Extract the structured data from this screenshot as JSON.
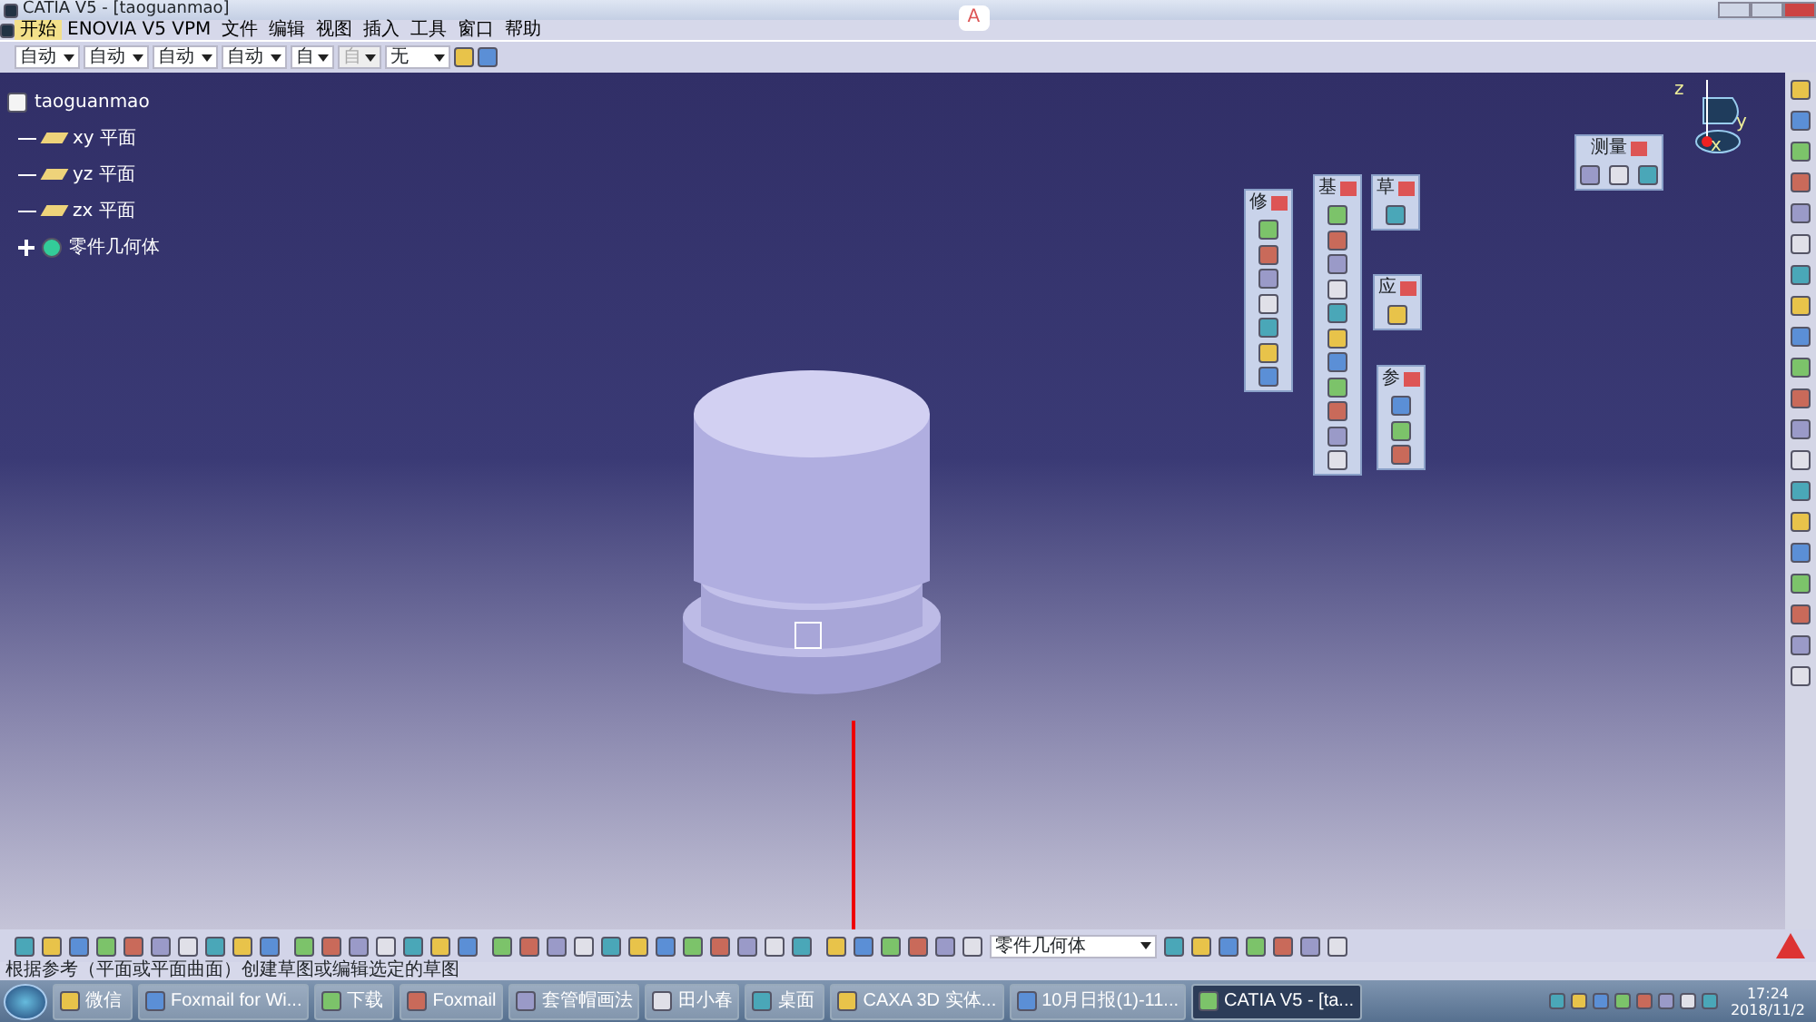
{
  "window": {
    "title": "CATIA V5 - [taoguanmao]"
  },
  "ime_bar": {
    "label": "A"
  },
  "menu": [
    {
      "label": "开始",
      "selected": true
    },
    {
      "label": "ENOVIA V5 VPM",
      "selected": false
    },
    {
      "label": "文件",
      "selected": false
    },
    {
      "label": "编辑",
      "selected": false
    },
    {
      "label": "视图",
      "selected": false
    },
    {
      "label": "插入",
      "selected": false
    },
    {
      "label": "工具",
      "selected": false
    },
    {
      "label": "窗口",
      "selected": false
    },
    {
      "label": "帮助",
      "selected": false
    }
  ],
  "style_toolbar": [
    {
      "value": "自动",
      "disabled": false
    },
    {
      "value": "自动",
      "disabled": false
    },
    {
      "value": "自动",
      "disabled": false
    },
    {
      "value": "自动",
      "disabled": false
    },
    {
      "value": "自",
      "disabled": false
    },
    {
      "value": "自",
      "disabled": true
    },
    {
      "value": "无",
      "disabled": false
    }
  ],
  "tree": {
    "label": "taoguanmao",
    "children": [
      {
        "label": "xy 平面",
        "kind": "plane"
      },
      {
        "label": "yz 平面",
        "kind": "plane"
      },
      {
        "label": "zx 平面",
        "kind": "plane"
      },
      {
        "label": "零件几何体",
        "kind": "body",
        "expanded": false
      }
    ]
  },
  "floating_toolbars": [
    {
      "title": "修"
    },
    {
      "title": "基"
    },
    {
      "title": "草"
    },
    {
      "title": "应"
    },
    {
      "title": "参"
    },
    {
      "title": "测量"
    }
  ],
  "compass": {
    "x_label": "x",
    "y_label": "y",
    "z_label": "z"
  },
  "bottom_toolbar": {
    "combo": "零件几何体"
  },
  "status_bar": {
    "message": "根据参考（平面或平面曲面）创建草图或编辑选定的草图"
  },
  "taskbar": {
    "buttons": [
      {
        "label": "微信",
        "selected": false
      },
      {
        "label": "Foxmail for Wi...",
        "selected": false
      },
      {
        "label": "下载",
        "selected": false
      },
      {
        "label": "Foxmail",
        "selected": false
      },
      {
        "label": "套管帽画法",
        "selected": false
      },
      {
        "label": "田小春",
        "selected": false
      },
      {
        "label": "桌面",
        "selected": false
      },
      {
        "label": "CAXA 3D 实体...",
        "selected": false
      },
      {
        "label": "10月日报(1)-11...",
        "selected": false
      },
      {
        "label": "CATIA V5 - [ta...",
        "selected": true
      }
    ],
    "time": "17:24",
    "date": "2018/11/2"
  }
}
